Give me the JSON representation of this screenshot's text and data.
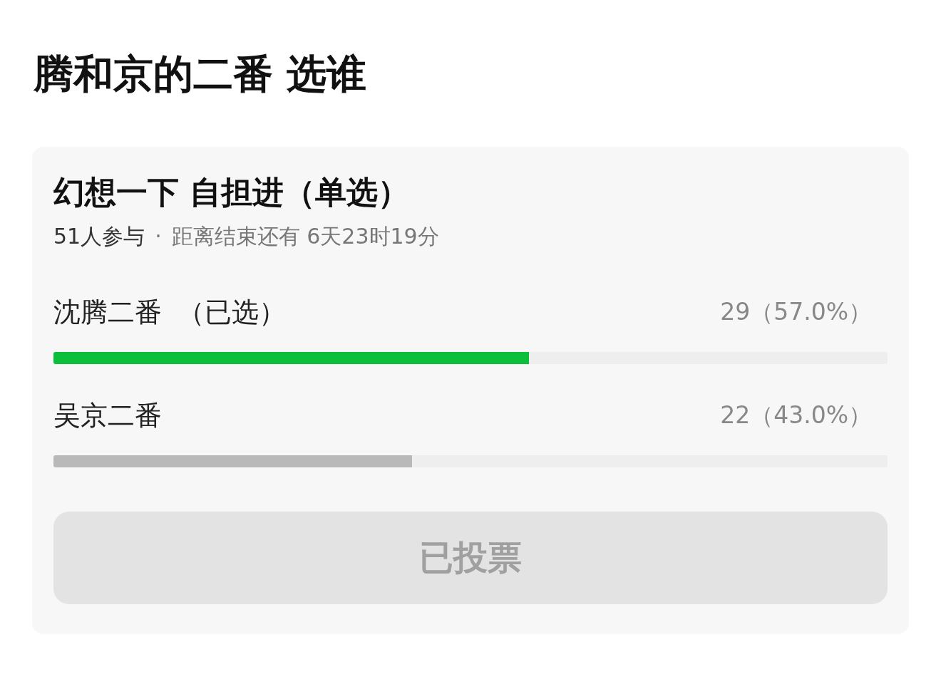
{
  "page": {
    "title": "腾和京的二番 选谁"
  },
  "poll": {
    "title": "幻想一下 自担进（单选）",
    "participants": "51人参与",
    "separator": "·",
    "remaining": "距离结束还有 6天23时19分",
    "options": [
      {
        "label": "沈腾二番",
        "note": "（已选）",
        "result": "29（57.0%）",
        "selected": true,
        "level": 0.57
      },
      {
        "label": "吴京二番",
        "result": "22（43.0%）",
        "selected": false,
        "level": 0.43
      }
    ],
    "button": {
      "label": "已投票",
      "disabled": true
    }
  }
}
